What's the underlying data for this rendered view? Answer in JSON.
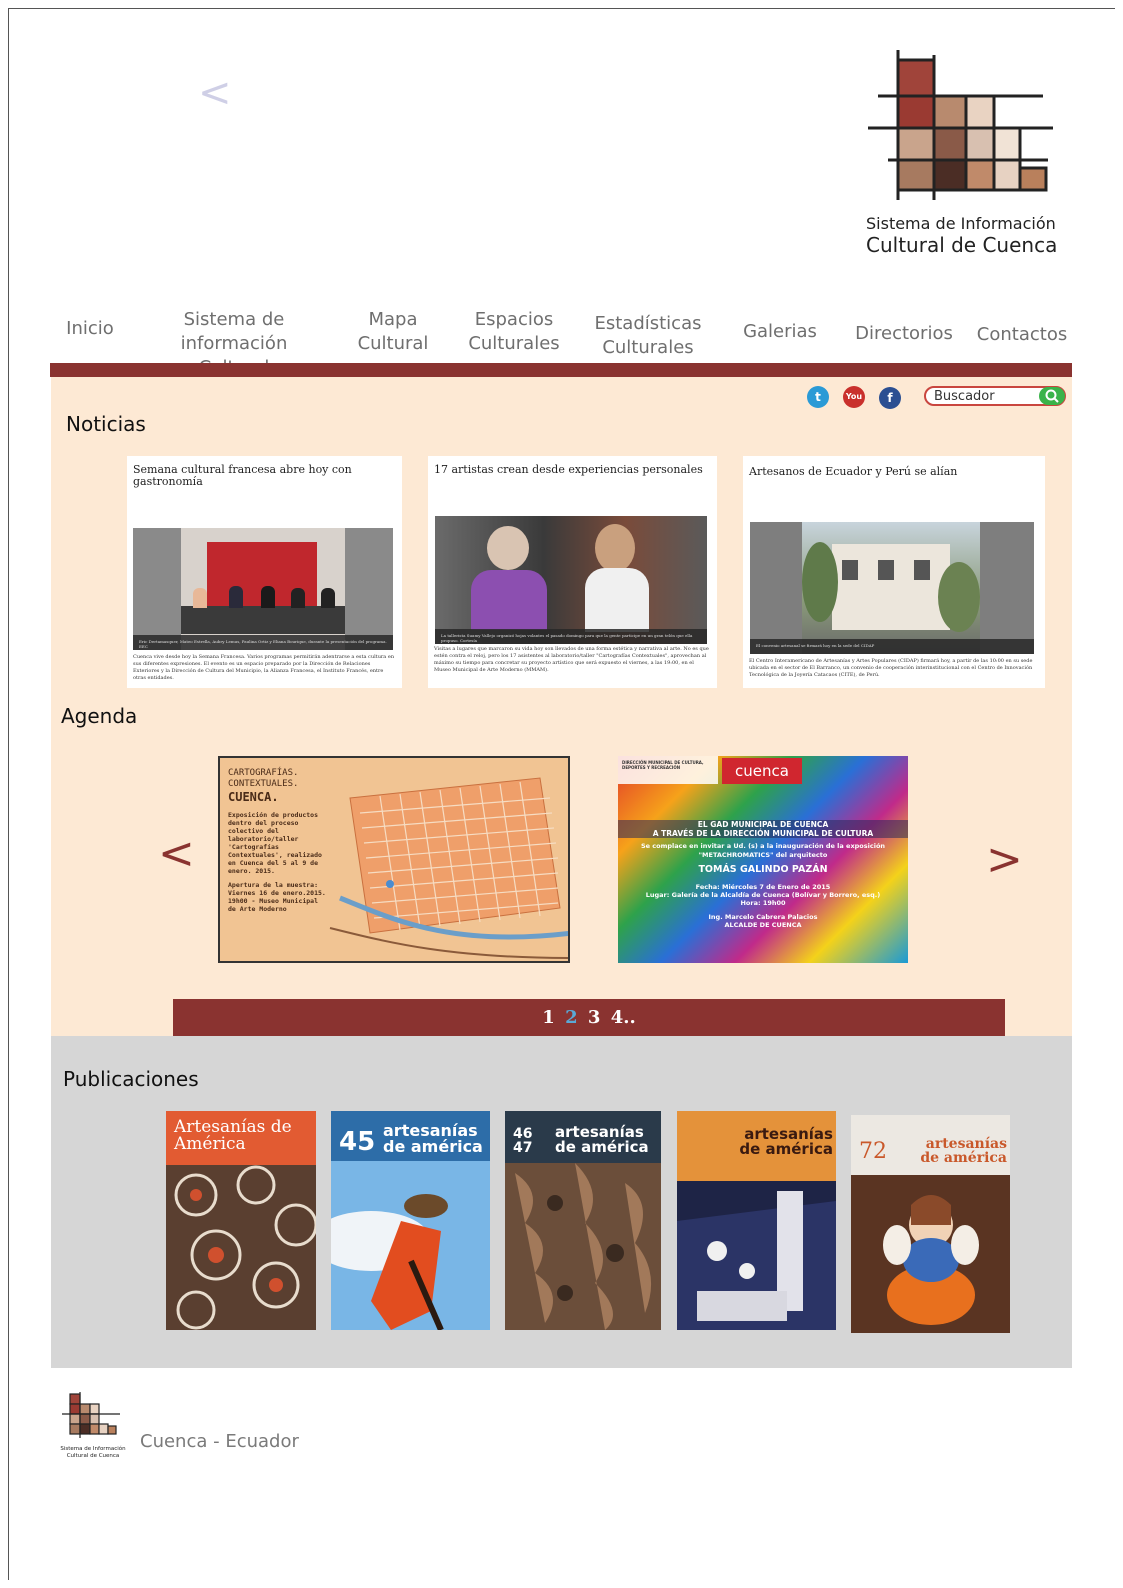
{
  "header": {
    "back_arrow": "<",
    "logo_line1": "Sistema de Información",
    "logo_line2": "Cultural de Cuenca"
  },
  "nav": {
    "items": [
      {
        "line1": "Inicio",
        "line2": ""
      },
      {
        "line1": "Sistema de",
        "line2": "información Cultural"
      },
      {
        "line1": "Mapa",
        "line2": "Cultural"
      },
      {
        "line1": "Espacios",
        "line2": "Culturales"
      },
      {
        "line1": "Estadísticas",
        "line2": "Culturales"
      },
      {
        "line1": "Galerias",
        "line2": ""
      },
      {
        "line1": "Directorios",
        "line2": ""
      },
      {
        "line1": "Contactos",
        "line2": ""
      }
    ]
  },
  "social": {
    "twitter": "t",
    "youtube": "You",
    "facebook": "f"
  },
  "search": {
    "placeholder": "Buscador"
  },
  "noticias": {
    "title": "Noticias",
    "cards": [
      {
        "title": "Semana cultural francesa abre hoy con gastronomía",
        "caption": "Eric Dertamasquer, Mateo Estrella, Aubry Lemus, Paulina Ortiz y Eliana Bourique, durante la presentación del programa. EEC",
        "body": "Cuenca vive desde hoy la Semana Francesa. Varios programas permitirán adentrarse a esta cultura en sus diferentes expresiones. El evento es un espacio preparado por la Dirección de Relaciones Exteriores y la Dirección de Cultura del Municipio, la Alianza Francesa, el Instituto Francés, entre otras entidades."
      },
      {
        "title": "17 artistas crean desde experiencias personales",
        "caption": "La tallerista Suamy Vallejo organizó hojas volantes el pasado domingo para que la gente participe en un gran telón que ella propuso. Cortesía",
        "body": "Visitas a lugares que marcaron su vida hoy son llevados de una forma estética y narrativa al arte. No es que estén contra el reloj, pero los 17 asistentes al laboratorio/taller \"Cartografías Contextuales\", aprovechan al máximo su tiempo para concretar su proyecto artístico que será expuesto el viernes, a las 19:00, en el Museo Municipal de Arte Moderno (MMAM)."
      },
      {
        "title": "Artesanos de Ecuador y Perú se alían",
        "caption": "El convenio artesanal se firmará hoy en la sede del CIDAP",
        "body": "El Centro Interamericano de Artesanías y Artes Populares (CIDAP) firmará hoy, a partir de las 10:00 en su sede ubicada en el sector de El Barranco, un convenio de cooperación interinstitucional con el Centro de Innovación Tecnológica de la Joyería Catacaos (CITE), de Perú."
      }
    ]
  },
  "agenda": {
    "title": "Agenda",
    "prev": "<",
    "next": ">",
    "map_poster": {
      "heading1": "CARTOGRAFÍAS.",
      "heading2": "CONTEXTUALES.",
      "heading3": "CUENCA.",
      "body": "Exposición de productos dentro del proceso colectivo del laboratorio/taller 'Cartografías Contextuales', realizado en Cuenca del 5 al 9 de enero. 2015.",
      "footer": "Apertura de la muestra: Viernes 16 de enero.2015. 19h00 - Museo Municipal de Arte Moderno"
    },
    "event_poster": {
      "org": "DIRECCIÓN MUNICIPAL DE CULTURA, DEPORTES Y RECREACIÓN",
      "brand": "cuenca",
      "l1": "EL GAD MUNICIPAL DE CUENCA",
      "l2": "A TRAVÉS DE LA DIRECCIÓN MUNICIPAL DE CULTURA",
      "l3": "Se complace en invitar a Ud. (s) a la inauguración de la exposición",
      "l4": "\"METACHROMATICS\" del arquitecto",
      "l5": "TOMÁS GALINDO PAZÁN",
      "l6": "Fecha: Miércoles 7 de Enero de 2015",
      "l7": "Lugar: Galería de la Alcaldía de Cuenca (Bolívar y Borrero, esq.)",
      "l8": "Hora: 19h00",
      "l9": "Ing. Marcelo Cabrera Palacios",
      "l10": "ALCALDE DE CUENCA"
    }
  },
  "pager": {
    "p1": "1",
    "p2": "2",
    "p3": "3",
    "p4": "4..",
    "active_color": "#5aa9d6"
  },
  "publicaciones": {
    "title": "Publicaciones",
    "covers": [
      {
        "title": "Artesanías de América",
        "number": ""
      },
      {
        "title": "artesanías de américa",
        "number": "45"
      },
      {
        "title": "artesanías de américa",
        "number": "46 47"
      },
      {
        "title": "artesanías de américa",
        "number": ""
      },
      {
        "title": "artesanías de américa",
        "number": "72"
      }
    ]
  },
  "footer": {
    "logo_line1": "Sistema de Información",
    "logo_line2": "Cultural de Cuenca",
    "location": "Cuenca - Ecuador"
  },
  "colors": {
    "brand_red": "#8a3330",
    "panel_cream": "#fde9d4",
    "panel_gray": "#d6d6d6"
  }
}
